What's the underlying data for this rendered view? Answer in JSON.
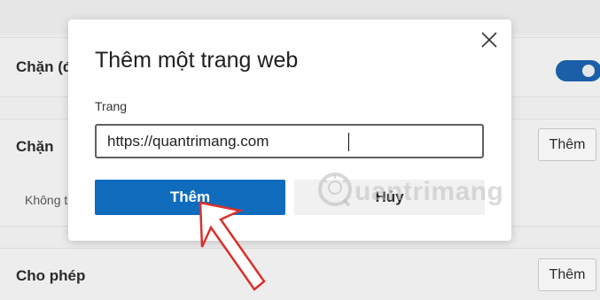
{
  "background": {
    "rows": [
      {
        "label": "Chặn (đ",
        "has_toggle": true
      },
      {
        "label": "Chặn",
        "button": "Thêm"
      },
      {
        "sub_label": "Không t"
      },
      {
        "label": "Cho phép",
        "button": "Thêm"
      }
    ],
    "toggle_state": "on"
  },
  "dialog": {
    "title": "Thêm một trang web",
    "field_label": "Trang",
    "url_value": "https://quantrimang.com",
    "primary_label": "Thêm",
    "secondary_label": "Hủy",
    "close_icon": "close-icon"
  },
  "watermark": {
    "text": "uantrimang",
    "icon": "lightbulb-logo"
  },
  "annotation": {
    "icon": "red-arrow-annotation"
  },
  "colors": {
    "accent": "#0f6cbd",
    "toggle_on": "#1a5fa8",
    "annotation_red": "#d9302c"
  }
}
